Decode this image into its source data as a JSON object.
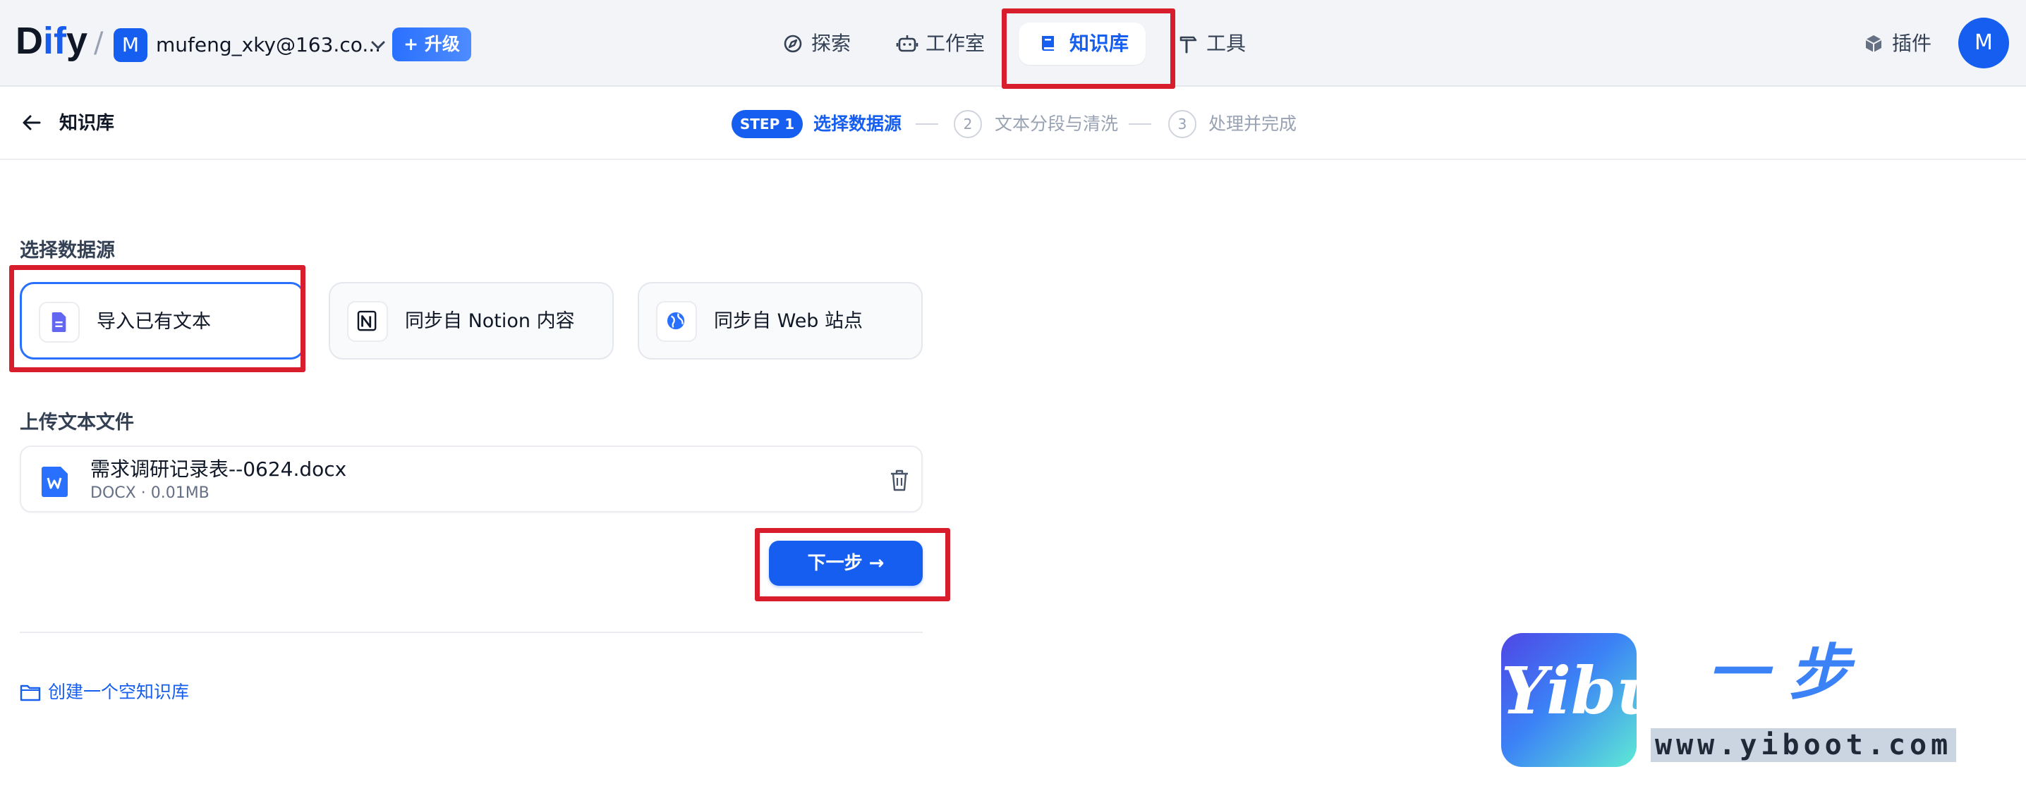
{
  "app": {
    "logo_prefix": "D",
    "logo_highlight": "if",
    "logo_suffix": "y",
    "logo_separator": "/",
    "workspace_initial": "M",
    "workspace_name": "mufeng_xky@163.co...",
    "upgrade_label": "+ 升级"
  },
  "nav": {
    "explore": "探索",
    "studio": "工作室",
    "knowledge": "知识库",
    "tools": "工具",
    "plugins": "插件",
    "user_initial": "M"
  },
  "subheader": {
    "breadcrumb": "知识库",
    "steps": [
      {
        "badge": "STEP 1",
        "label": "选择数据源",
        "state": "active"
      },
      {
        "badge": "2",
        "label": "文本分段与清洗",
        "state": "pending"
      },
      {
        "badge": "3",
        "label": "处理并完成",
        "state": "pending"
      }
    ]
  },
  "main": {
    "datasource_title": "选择数据源",
    "sources": [
      {
        "label": "导入已有文本",
        "icon": "document-icon",
        "selected": true
      },
      {
        "label": "同步自 Notion 内容",
        "icon": "notion-icon",
        "selected": false
      },
      {
        "label": "同步自 Web 站点",
        "icon": "web-globe-icon",
        "selected": false
      }
    ],
    "upload_title": "上传文本文件",
    "file": {
      "name": "需求调研记录表--0624.docx",
      "type": "DOCX",
      "separator": "·",
      "size": "0.01MB"
    },
    "next_button": "下一步 →",
    "create_empty": "创建一个空知识库"
  },
  "watermark": {
    "logo_text": "Yibu",
    "chinese": "一步",
    "url": "www.yiboot.com"
  },
  "colors": {
    "primary": "#155eef",
    "highlight_box": "#d81e2c",
    "topbar_bg": "#f2f4f7"
  }
}
